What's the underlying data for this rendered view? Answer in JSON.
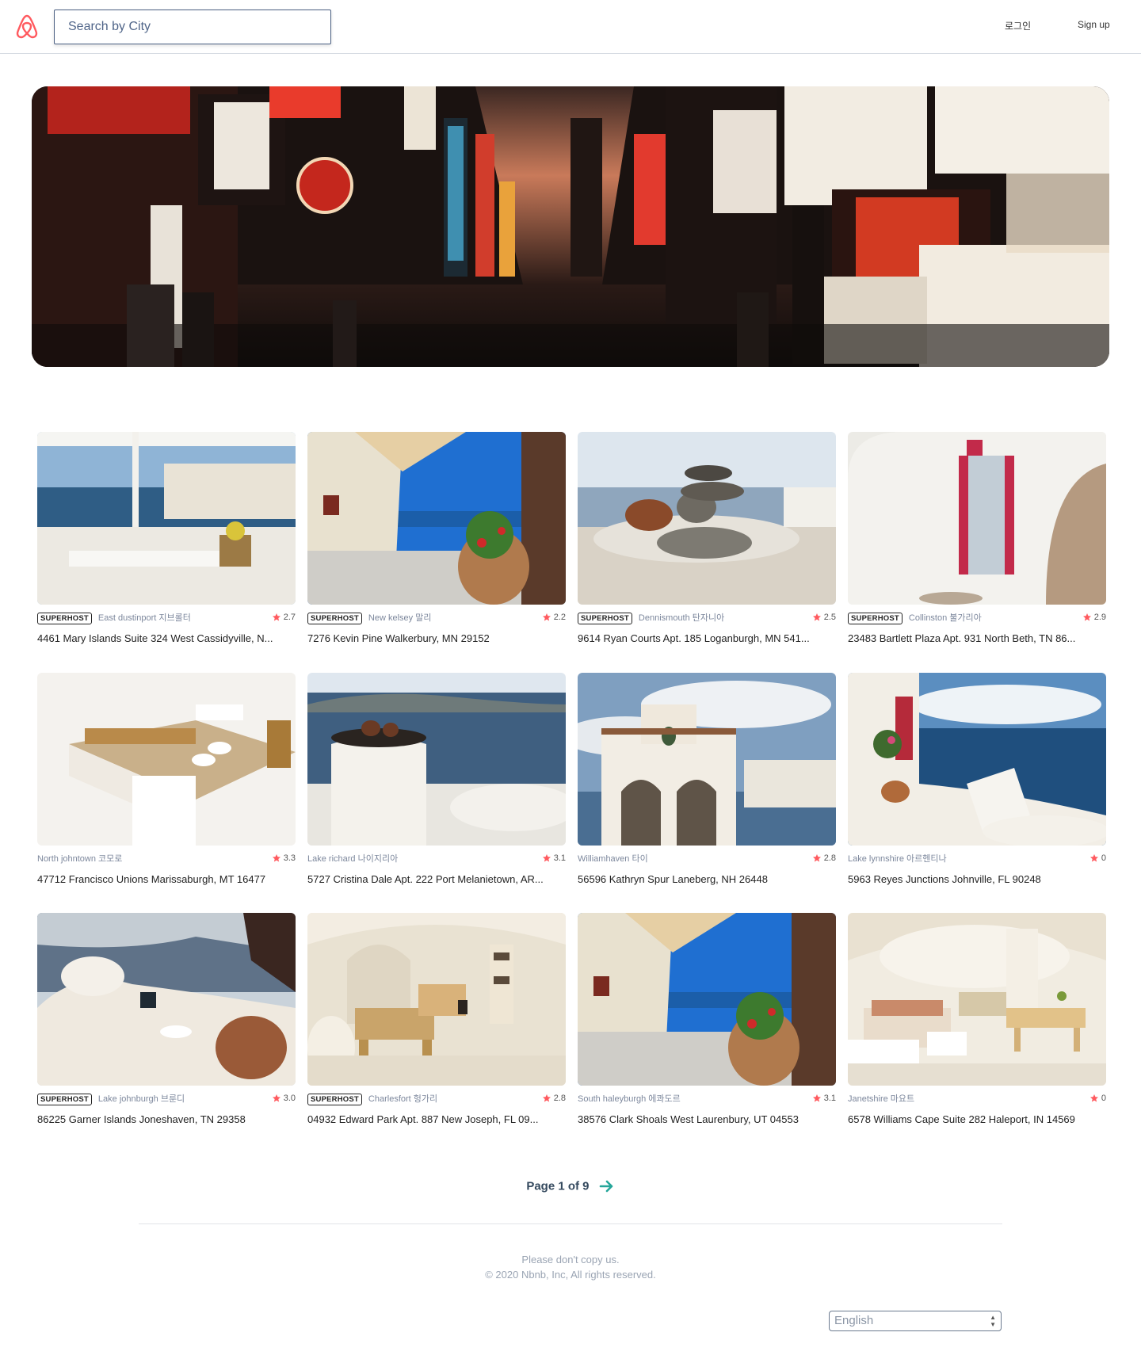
{
  "header": {
    "logo": "airbnb-logo",
    "search_placeholder": "Search by City",
    "login_label": "로그인",
    "signup_label": "Sign up"
  },
  "hero": {
    "image": "korean-neon-street-photo"
  },
  "listings": [
    {
      "superhost": "SUPERHOST",
      "city": "East dustinport 지브롤터",
      "rating": "2.7",
      "address": "4461 Mary Islands Suite 324 West Cassidyville, N...",
      "photo": "santorini-terrace-sea-view"
    },
    {
      "superhost": "SUPERHOST",
      "city": "New kelsey 말리",
      "rating": "2.2",
      "address": "7276 Kevin Pine Walkerbury, MN 29152",
      "photo": "whitewashed-patio-flowers"
    },
    {
      "superhost": "SUPERHOST",
      "city": "Dennismouth 탄자니아",
      "rating": "2.5",
      "address": "9614 Ryan Courts Apt. 185 Loganburgh, MN 541...",
      "photo": "stacked-stones-sea"
    },
    {
      "superhost": "SUPERHOST",
      "city": "Collinston 불가리아",
      "rating": "2.9",
      "address": "23483 Bartlett Plaza Apt. 931 North Beth, TN 86...",
      "photo": "white-cave-doorway"
    },
    {
      "superhost": "",
      "city": "North johntown 코모로",
      "rating": "3.3",
      "address": "47712 Francisco Unions Marissaburgh, MT 16477",
      "photo": "white-bedroom"
    },
    {
      "superhost": "",
      "city": "Lake richard 나이지리아",
      "rating": "3.1",
      "address": "5727 Cristina Dale Apt. 222 Port Melanietown, AR...",
      "photo": "white-chimney-sea"
    },
    {
      "superhost": "",
      "city": "Williamhaven 타이",
      "rating": "2.8",
      "address": "56596 Kathryn Spur Laneberg, NH 26448",
      "photo": "bell-tower"
    },
    {
      "superhost": "",
      "city": "Lake lynnshire 아르헨티나",
      "rating": "0",
      "address": "5963 Reyes Junctions Johnville, FL 90248",
      "photo": "sea-terrace-lounger"
    },
    {
      "superhost": "SUPERHOST",
      "city": "Lake johnburgh 브룬디",
      "rating": "3.0",
      "address": "86225 Garner Islands Joneshaven, TN 29358",
      "photo": "cliff-houses"
    },
    {
      "superhost": "SUPERHOST",
      "city": "Charlesfort 헝가리",
      "rating": "2.8",
      "address": "04932 Edward Park Apt. 887 New Joseph, FL 09...",
      "photo": "cave-dining-room"
    },
    {
      "superhost": "",
      "city": "South haleyburgh 에콰도르",
      "rating": "3.1",
      "address": "38576 Clark Shoals West Laurenbury, UT 04553",
      "photo": "whitewashed-patio-flowers"
    },
    {
      "superhost": "",
      "city": "Janetshire 마요트",
      "rating": "0",
      "address": "6578 Williams Cape Suite 282 Haleport, IN 14569",
      "photo": "cave-living-room"
    }
  ],
  "pagination": {
    "label": "Page 1 of 9",
    "next_icon": "arrow-right-icon"
  },
  "footer": {
    "line1": "Please don't copy us.",
    "line2": "© 2020 Nbnb, Inc, All rights reserved.",
    "language": "English"
  },
  "colors": {
    "brand": "#ff5a5f",
    "star": "#ff5a5f",
    "teal_arrow": "#26a69a",
    "muted_text": "#7c879c"
  }
}
